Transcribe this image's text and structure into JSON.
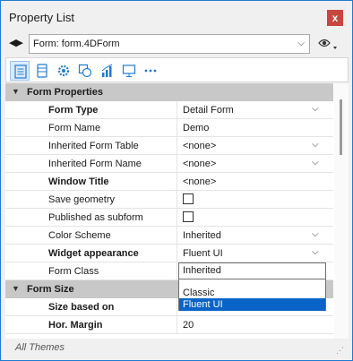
{
  "window": {
    "title": "Property List",
    "close_glyph": "x"
  },
  "selector": {
    "nav_glyph": "◀▶",
    "value": "Form: form.4DForm",
    "chevron_glyph": "⌵",
    "eye_icon": "eye-icon"
  },
  "toolbar": {
    "tools": [
      {
        "icon": "list-icon",
        "active": true
      },
      {
        "icon": "database-icon"
      },
      {
        "icon": "gear-icon"
      },
      {
        "icon": "shapes-icon"
      },
      {
        "icon": "bar-chart-icon"
      },
      {
        "icon": "monitor-icon"
      },
      {
        "icon": "more-icon"
      }
    ]
  },
  "properties": {
    "section_form_properties": "Form Properties",
    "form_type": {
      "name": "Form Type",
      "value": "Detail Form"
    },
    "form_name": {
      "name": "Form Name",
      "value": "Demo"
    },
    "inherited_form_table": {
      "name": "Inherited Form Table",
      "value": "<none>"
    },
    "inherited_form_name": {
      "name": "Inherited Form Name",
      "value": "<none>"
    },
    "window_title": {
      "name": "Window Title",
      "value": "<none>"
    },
    "save_geometry": {
      "name": "Save geometry",
      "checked": false
    },
    "published_as_subform": {
      "name": "Published as subform",
      "checked": false
    },
    "color_scheme": {
      "name": "Color Scheme",
      "value": "Inherited"
    },
    "widget_appearance": {
      "name": "Widget appearance",
      "value": "Fluent UI"
    },
    "form_class": {
      "name": "Form Class",
      "value": ""
    },
    "section_form_size": "Form Size",
    "size_based_on": {
      "name": "Size based on",
      "value": ""
    },
    "hor_margin": {
      "name": "Hor. Margin",
      "value": "20"
    }
  },
  "dropdown": {
    "items": [
      "Inherited",
      "Classic",
      "Fluent UI"
    ],
    "selected": "Fluent UI"
  },
  "status": {
    "text": "All Themes"
  },
  "colors": {
    "accent": "#1f7ad1",
    "selection": "#0a64c8",
    "section_bg": "#c8c8c8",
    "close": "#c9453f"
  }
}
